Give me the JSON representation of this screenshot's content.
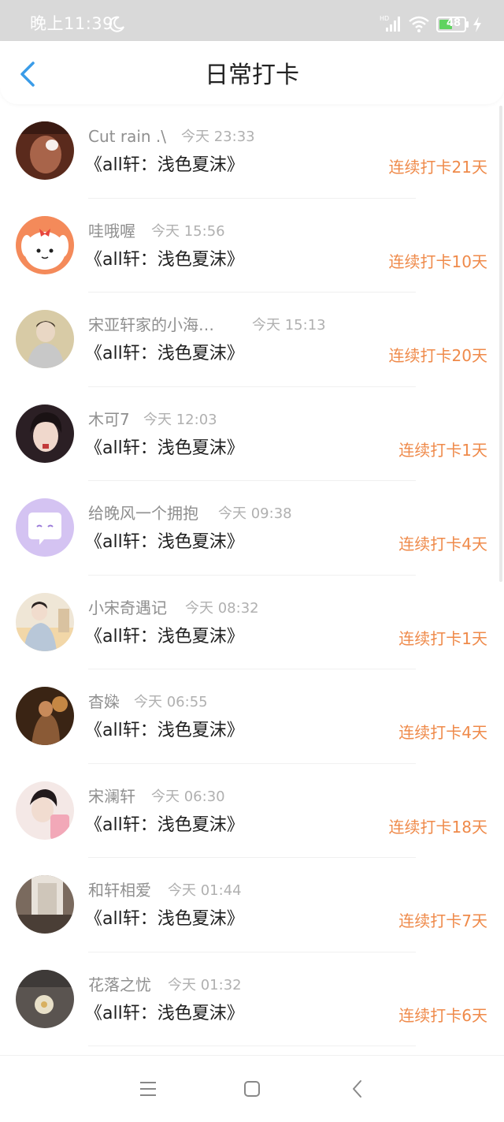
{
  "status_bar": {
    "time": "晚上11:39",
    "battery": "48"
  },
  "header": {
    "title": "日常打卡"
  },
  "items": [
    {
      "name": "Cut rain .\\",
      "time": "今天 23:33",
      "book": "《all轩：浅色夏沫》",
      "streak": "连续打卡21天"
    },
    {
      "name": "哇哦喔",
      "time": "今天 15:56",
      "book": "《all轩：浅色夏沫》",
      "streak": "连续打卡10天"
    },
    {
      "name": "宋亚轩家的小海…",
      "time": "今天 15:13",
      "book": "《all轩：浅色夏沫》",
      "streak": "连续打卡20天"
    },
    {
      "name": "木可7",
      "time": "今天 12:03",
      "book": "《all轩：浅色夏沫》",
      "streak": "连续打卡1天"
    },
    {
      "name": "给晚风一个拥抱",
      "time": "今天 09:38",
      "book": "《all轩：浅色夏沫》",
      "streak": "连续打卡4天"
    },
    {
      "name": "小宋奇遇记",
      "time": "今天 08:32",
      "book": "《all轩：浅色夏沫》",
      "streak": "连续打卡1天"
    },
    {
      "name": "杳媣",
      "time": "今天 06:55",
      "book": "《all轩：浅色夏沫》",
      "streak": "连续打卡4天"
    },
    {
      "name": "宋澜轩",
      "time": "今天 06:30",
      "book": "《all轩：浅色夏沫》",
      "streak": "连续打卡18天"
    },
    {
      "name": "和轩相爱",
      "time": "今天 01:44",
      "book": "《all轩：浅色夏沫》",
      "streak": "连续打卡7天"
    },
    {
      "name": "花落之忧",
      "time": "今天 01:32",
      "book": "《all轩：浅色夏沫》",
      "streak": "连续打卡6天"
    }
  ],
  "colors": {
    "accent": "#ef8a4a",
    "back_arrow": "#3a9ce8",
    "status_bar_bg": "#d9d9d9",
    "username": "#8f8f8f",
    "timestamp": "#b0b0b0"
  },
  "icons": {
    "back": "back-arrow-icon",
    "menu": "menu-icon",
    "home": "home-icon",
    "nav_back": "nav-back-icon",
    "moon": "moon-icon",
    "signal": "signal-icon",
    "wifi": "wifi-icon",
    "battery": "battery-icon",
    "charging": "charging-icon"
  }
}
